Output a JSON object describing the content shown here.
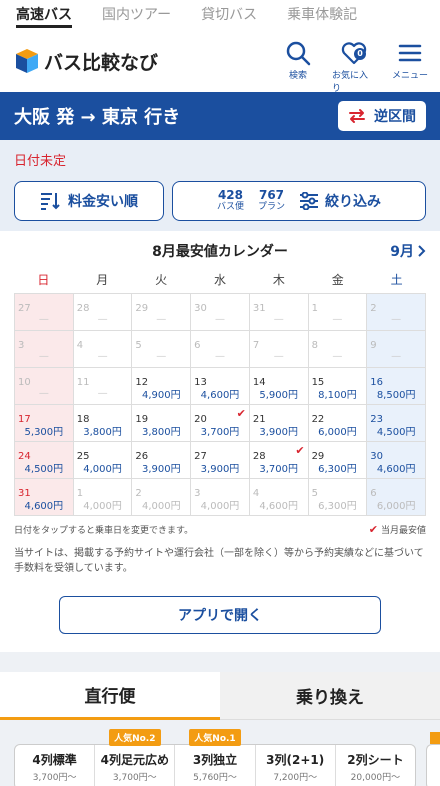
{
  "topnav": [
    "高速バス",
    "国内ツアー",
    "貸切バス",
    "乗車体験記"
  ],
  "brand": {
    "name": "バス比較なび",
    "accent": "#1b4f9f",
    "orange": "#f39c12",
    "red": "#d8252f"
  },
  "header_icons": {
    "search": "検索",
    "favorites": "お気に入り",
    "favorites_count": "0",
    "menu": "メニュー"
  },
  "route": {
    "title": "大阪 発 → 東京 行き",
    "reverse_label": "逆区間"
  },
  "filters": {
    "date_status": "日付未定",
    "sort_label": "料金安い順",
    "bus_count": "428",
    "bus_label": "バス便",
    "plan_count": "767",
    "plan_label": "プラン",
    "narrow_label": "絞り込み"
  },
  "calendar": {
    "title": "8月最安値カレンダー",
    "next_label": "9月",
    "weekdays": [
      "日",
      "月",
      "火",
      "水",
      "木",
      "金",
      "土"
    ],
    "cells": [
      {
        "day": "27",
        "price": "—",
        "off": true
      },
      {
        "day": "28",
        "price": "—",
        "off": true
      },
      {
        "day": "29",
        "price": "—",
        "off": true
      },
      {
        "day": "30",
        "price": "—",
        "off": true
      },
      {
        "day": "31",
        "price": "—",
        "off": true
      },
      {
        "day": "1",
        "price": "—",
        "off": true
      },
      {
        "day": "2",
        "price": "—",
        "off": true
      },
      {
        "day": "3",
        "price": "—",
        "off": true
      },
      {
        "day": "4",
        "price": "—",
        "off": true
      },
      {
        "day": "5",
        "price": "—",
        "off": true
      },
      {
        "day": "6",
        "price": "—",
        "off": true
      },
      {
        "day": "7",
        "price": "—",
        "off": true
      },
      {
        "day": "8",
        "price": "—",
        "off": true
      },
      {
        "day": "9",
        "price": "—",
        "off": true
      },
      {
        "day": "10",
        "price": "—",
        "off": true
      },
      {
        "day": "11",
        "price": "—",
        "off": true
      },
      {
        "day": "12",
        "price": "4,900円"
      },
      {
        "day": "13",
        "price": "4,600円"
      },
      {
        "day": "14",
        "price": "5,900円"
      },
      {
        "day": "15",
        "price": "8,100円"
      },
      {
        "day": "16",
        "price": "8,500円"
      },
      {
        "day": "17",
        "price": "5,300円"
      },
      {
        "day": "18",
        "price": "3,800円"
      },
      {
        "day": "19",
        "price": "3,800円"
      },
      {
        "day": "20",
        "price": "3,700円",
        "cheapest": true
      },
      {
        "day": "21",
        "price": "3,900円"
      },
      {
        "day": "22",
        "price": "6,000円"
      },
      {
        "day": "23",
        "price": "4,500円"
      },
      {
        "day": "24",
        "price": "4,500円"
      },
      {
        "day": "25",
        "price": "4,000円"
      },
      {
        "day": "26",
        "price": "3,900円"
      },
      {
        "day": "27",
        "price": "3,900円"
      },
      {
        "day": "28",
        "price": "3,700円",
        "cheapest": true
      },
      {
        "day": "29",
        "price": "6,300円"
      },
      {
        "day": "30",
        "price": "4,600円"
      },
      {
        "day": "31",
        "price": "4,600円"
      },
      {
        "day": "1",
        "price": "4,000円",
        "off": true
      },
      {
        "day": "2",
        "price": "4,000円",
        "off": true
      },
      {
        "day": "3",
        "price": "4,000円",
        "off": true
      },
      {
        "day": "4",
        "price": "4,600円",
        "off": true
      },
      {
        "day": "5",
        "price": "6,300円",
        "off": true
      },
      {
        "day": "6",
        "price": "6,000円",
        "off": true
      }
    ],
    "hint": "日付をタップすると乗車日を変更できます。",
    "legend": "当月最安値",
    "disclaimer": "当サイトは、掲載する予約サイトや運行会社（一部を除く）等から予約実績などに基づいて手数料を受領しています。"
  },
  "app_button": "アプリで開く",
  "route_tabs": [
    "直行便",
    "乗り換え"
  ],
  "seats": [
    {
      "name": "4列標準",
      "price": "3,700円〜",
      "badge": ""
    },
    {
      "name": "4列足元広め",
      "price": "3,700円〜",
      "badge": "人気No.2"
    },
    {
      "name": "3列独立",
      "price": "5,760円〜",
      "badge": "人気No.1"
    },
    {
      "name": "3列(2+1)",
      "price": "7,200円〜",
      "badge": ""
    },
    {
      "name": "2列シート",
      "price": "20,000円〜",
      "badge": ""
    }
  ]
}
